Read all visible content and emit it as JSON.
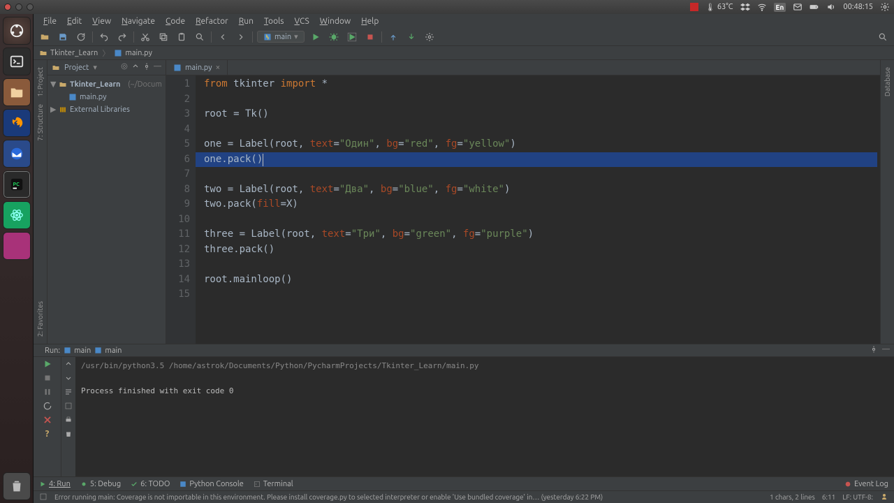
{
  "os": {
    "temp": "63°C",
    "lang": "En",
    "time": "00:48:15"
  },
  "menu": [
    "File",
    "Edit",
    "View",
    "Navigate",
    "Code",
    "Refactor",
    "Run",
    "Tools",
    "VCS",
    "Window",
    "Help"
  ],
  "runconfig": "main",
  "breadcrumb": {
    "project": "Tkinter_Learn",
    "file": "main.py"
  },
  "leftTabs": [
    "1: Project",
    "7: Structure",
    "2: Favorites"
  ],
  "rightTabs": [
    "Database"
  ],
  "project": {
    "title": "Project",
    "root": "Tkinter_Learn",
    "rootHint": "(~/Docum",
    "file": "main.py",
    "ext": "External Libraries"
  },
  "tab": {
    "name": "main.py"
  },
  "code": {
    "lines": [
      {
        "n": 1,
        "seg": [
          [
            "kw",
            "from "
          ],
          [
            "name",
            "tkinter "
          ],
          [
            "kw",
            "import "
          ],
          [
            "name",
            "*"
          ]
        ]
      },
      {
        "n": 2,
        "seg": []
      },
      {
        "n": 3,
        "seg": [
          [
            "name",
            "root = Tk()"
          ]
        ]
      },
      {
        "n": 4,
        "seg": []
      },
      {
        "n": 5,
        "seg": [
          [
            "name",
            "one = Label(root, "
          ],
          [
            "argn",
            "text"
          ],
          [
            "name",
            "="
          ],
          [
            "str",
            "\"Один\""
          ],
          [
            "name",
            ", "
          ],
          [
            "argn",
            "bg"
          ],
          [
            "name",
            "="
          ],
          [
            "str",
            "\"red\""
          ],
          [
            "name",
            ", "
          ],
          [
            "argn",
            "fg"
          ],
          [
            "name",
            "="
          ],
          [
            "str",
            "\"yellow\""
          ],
          [
            "name",
            ")"
          ]
        ]
      },
      {
        "n": 6,
        "seg": [
          [
            "name",
            "one.pack()"
          ]
        ]
      },
      {
        "n": 7,
        "seg": []
      },
      {
        "n": 8,
        "seg": [
          [
            "name",
            "two = Label(root, "
          ],
          [
            "argn",
            "text"
          ],
          [
            "name",
            "="
          ],
          [
            "str",
            "\"Два\""
          ],
          [
            "name",
            ", "
          ],
          [
            "argn",
            "bg"
          ],
          [
            "name",
            "="
          ],
          [
            "str",
            "\"blue\""
          ],
          [
            "name",
            ", "
          ],
          [
            "argn",
            "fg"
          ],
          [
            "name",
            "="
          ],
          [
            "str",
            "\"white\""
          ],
          [
            "name",
            ")"
          ]
        ]
      },
      {
        "n": 9,
        "seg": [
          [
            "name",
            "two.pack("
          ],
          [
            "argn",
            "fill"
          ],
          [
            "name",
            "=X)"
          ]
        ]
      },
      {
        "n": 10,
        "seg": []
      },
      {
        "n": 11,
        "seg": [
          [
            "name",
            "three = Label(root, "
          ],
          [
            "argn",
            "text"
          ],
          [
            "name",
            "="
          ],
          [
            "str",
            "\"Три\""
          ],
          [
            "name",
            ", "
          ],
          [
            "argn",
            "bg"
          ],
          [
            "name",
            "="
          ],
          [
            "str",
            "\"green\""
          ],
          [
            "name",
            ", "
          ],
          [
            "argn",
            "fg"
          ],
          [
            "name",
            "="
          ],
          [
            "str",
            "\"purple\""
          ],
          [
            "name",
            ")"
          ]
        ]
      },
      {
        "n": 12,
        "seg": [
          [
            "name",
            "three.pack()"
          ]
        ]
      },
      {
        "n": 13,
        "seg": []
      },
      {
        "n": 14,
        "seg": [
          [
            "name",
            "root.mainloop()"
          ]
        ]
      },
      {
        "n": 15,
        "seg": []
      }
    ],
    "highlightLine": 6
  },
  "run": {
    "title": "Run:",
    "cfg1": "main",
    "cfg2": "main",
    "cmd": "/usr/bin/python3.5  /home/astrok/Documents/Python/PycharmProjects/Tkinter_Learn/main.py",
    "out": "Process finished with exit code 0"
  },
  "bottom": {
    "tabs": [
      "4: Run",
      "5: Debug",
      "6: TODO",
      "Python Console",
      "Terminal"
    ],
    "eventlog": "Event Log"
  },
  "status": {
    "msg": "Error running main: Coverage is not importable in this environment. Please install coverage.py to selected interpreter or enable 'Use bundled coverage' in… (yesterday 6:22 PM)",
    "sel": "1 chars, 2 lines",
    "pos": "6:11",
    "enc": "LF: UTF-8:"
  }
}
